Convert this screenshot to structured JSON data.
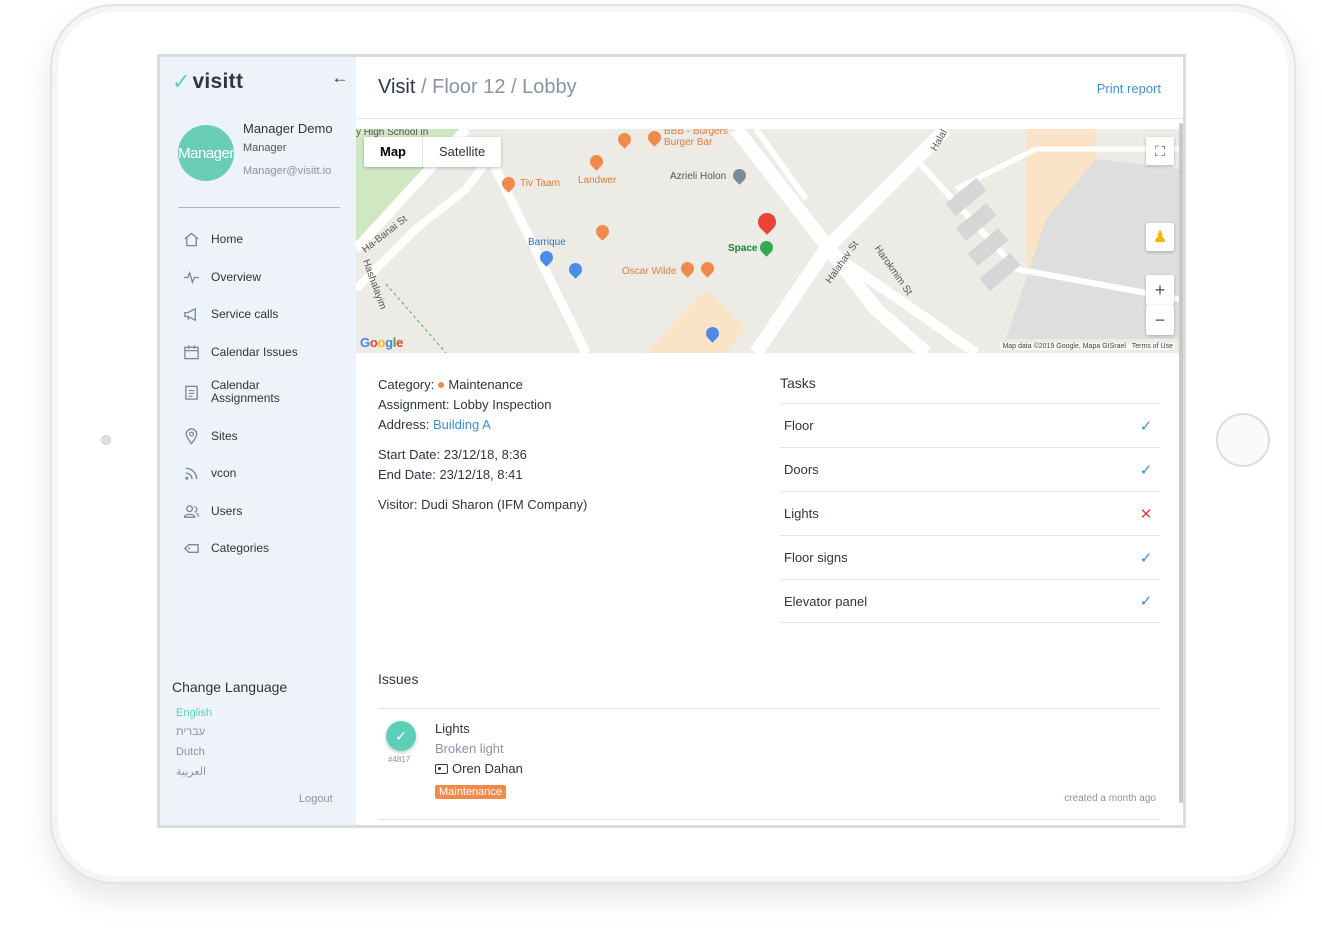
{
  "app": {
    "logo_text": "visitt",
    "collapse_icon": "arrow-left-icon"
  },
  "user": {
    "avatar_text": "Manager",
    "name": "Manager Demo",
    "role": "Manager",
    "email": "Manager@visitt.io"
  },
  "sidebar": {
    "items": [
      {
        "label": "Home",
        "icon": "home-icon"
      },
      {
        "label": "Overview",
        "icon": "pulse-icon"
      },
      {
        "label": "Service calls",
        "icon": "megaphone-icon"
      },
      {
        "label": "Calendar Issues",
        "icon": "calendar-icon"
      },
      {
        "label": "Calendar Assignments",
        "icon": "calendar-list-icon"
      },
      {
        "label": "Sites",
        "icon": "location-pin-icon"
      },
      {
        "label": "vcon",
        "icon": "rss-icon"
      },
      {
        "label": "Users",
        "icon": "users-icon"
      },
      {
        "label": "Categories",
        "icon": "tag-icon"
      }
    ],
    "language_title": "Change Language",
    "languages": [
      "English",
      "עברית",
      "Dutch",
      "العربية"
    ],
    "active_language": "English",
    "logout_label": "Logout"
  },
  "header": {
    "breadcrumb_root": "Visit",
    "separator": "/",
    "breadcrumb_floor": "Floor 12",
    "breadcrumb_area": "Lobby",
    "print_label": "Print report"
  },
  "map": {
    "toggle_map": "Map",
    "toggle_satellite": "Satellite",
    "labels": {
      "bbb": "BBB - Burgers",
      "bbb2": "Burger Bar",
      "tiv_taam": "Tiv Taam",
      "landwer": "Landwer",
      "azrieli": "Azrieli Holon",
      "barrique": "Barrique",
      "oscar": "Oscar Wilde",
      "space": "Space",
      "street1": "Ha-Banai St",
      "street2": "Halahav St",
      "street3": "Harokmim St",
      "street4": "Hashalayim",
      "street5": "Halal",
      "street6": "y High School in"
    },
    "google": "Google",
    "attribution": "Map data ©2019 Google, Mapa GISrael",
    "terms": "Terms of Use",
    "fullscreen_icon": "fullscreen-icon",
    "pegman_icon": "pegman-icon",
    "zoom_in": "+",
    "zoom_out": "−"
  },
  "details": {
    "category_label": "Category:",
    "category_value": "Maintenance",
    "category_color": "#f08a4b",
    "assignment_label": "Assignment:",
    "assignment_value": "Lobby Inspection",
    "address_label": "Address:",
    "address_value": "Building A",
    "start_label": "Start Date:",
    "start_value": "23/12/18, 8:36",
    "end_label": "End Date:",
    "end_value": "23/12/18, 8:41",
    "visitor_label": "Visitor:",
    "visitor_value": "Dudi Sharon (IFM Company)"
  },
  "tasks": {
    "title": "Tasks",
    "items": [
      {
        "label": "Floor",
        "status": "✓",
        "ok": true
      },
      {
        "label": "Doors",
        "status": "✓",
        "ok": true
      },
      {
        "label": "Lights",
        "status": "✕",
        "ok": false
      },
      {
        "label": "Floor signs",
        "status": "✓",
        "ok": true
      },
      {
        "label": "Elevator panel",
        "status": "✓",
        "ok": true
      }
    ]
  },
  "issues": {
    "title": "Issues",
    "items": [
      {
        "number": "#4817",
        "title": "Lights",
        "description": "Broken light",
        "assignee": "Oren Dahan",
        "tag": "Maintenance",
        "tag_color": "#f08a4b",
        "created": "created a month ago"
      }
    ]
  },
  "colors": {
    "accent_teal": "#5ccfb8",
    "link_blue": "#3f8fd8",
    "error_red": "#e53e3e",
    "sidebar_bg": "#eef3fa"
  }
}
